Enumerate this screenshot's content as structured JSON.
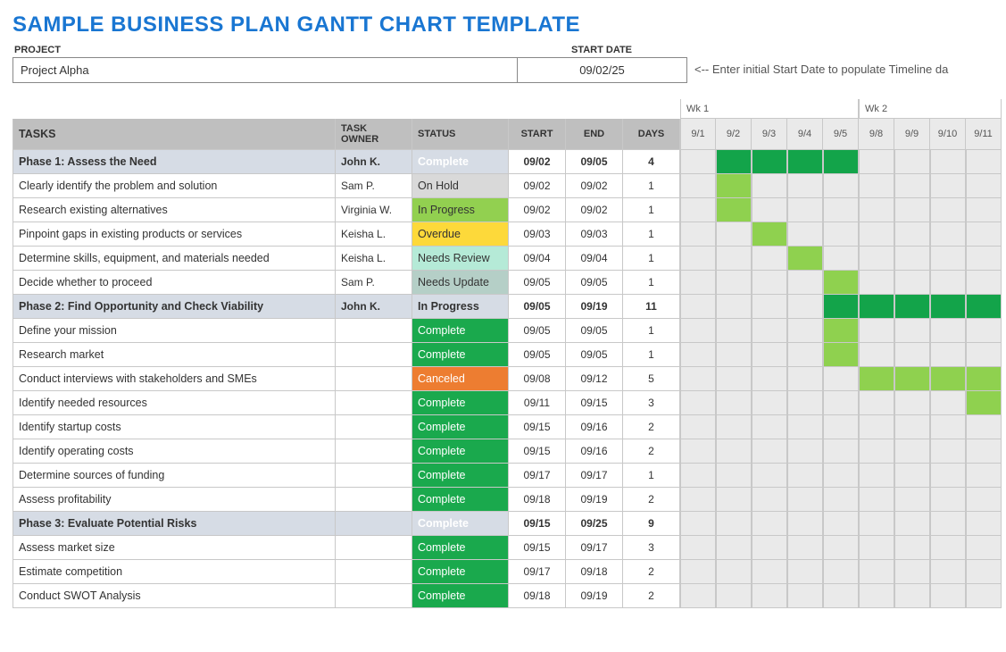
{
  "title": "SAMPLE BUSINESS PLAN GANTT CHART TEMPLATE",
  "meta": {
    "project_label": "PROJECT",
    "project_name": "Project Alpha",
    "start_label": "START DATE",
    "start_date": "09/02/25",
    "note": "<-- Enter initial Start Date to populate Timeline da"
  },
  "headers": {
    "tasks": "TASKS",
    "owner": "TASK OWNER",
    "status": "STATUS",
    "start": "START",
    "end": "END",
    "days": "DAYS"
  },
  "weeks": [
    {
      "label": "Wk 1",
      "dates": [
        "9/1",
        "9/2",
        "9/3",
        "9/4",
        "9/5"
      ]
    },
    {
      "label": "Wk 2",
      "dates": [
        "9/8",
        "9/9",
        "9/10",
        "9/11"
      ]
    }
  ],
  "status_classes": {
    "Complete": "st-complete",
    "On Hold": "st-onhold",
    "In Progress": "st-inprogress",
    "Overdue": "st-overdue",
    "Needs Review": "st-needsreview",
    "Needs Update": "st-needsupdate",
    "Canceled": "st-canceled"
  },
  "timeline_dates": [
    "9/1",
    "9/2",
    "9/3",
    "9/4",
    "9/5",
    "9/8",
    "9/9",
    "9/10",
    "9/11"
  ],
  "rows": [
    {
      "phase": true,
      "task": "Phase 1: Assess the Need",
      "owner": "John K.",
      "status": "Complete",
      "start": "09/02",
      "end": "09/05",
      "days": "4",
      "bars": [
        0,
        1,
        1,
        1,
        1,
        0,
        0,
        0,
        0
      ],
      "bar_type": "phase"
    },
    {
      "phase": false,
      "task": "Clearly identify the problem and solution",
      "owner": "Sam P.",
      "status": "On Hold",
      "start": "09/02",
      "end": "09/02",
      "days": "1",
      "bars": [
        0,
        1,
        0,
        0,
        0,
        0,
        0,
        0,
        0
      ],
      "bar_type": "task"
    },
    {
      "phase": false,
      "task": "Research existing alternatives",
      "owner": "Virginia W.",
      "status": "In Progress",
      "start": "09/02",
      "end": "09/02",
      "days": "1",
      "bars": [
        0,
        1,
        0,
        0,
        0,
        0,
        0,
        0,
        0
      ],
      "bar_type": "task"
    },
    {
      "phase": false,
      "task": "Pinpoint gaps in existing products or services",
      "owner": "Keisha L.",
      "status": "Overdue",
      "start": "09/03",
      "end": "09/03",
      "days": "1",
      "bars": [
        0,
        0,
        1,
        0,
        0,
        0,
        0,
        0,
        0
      ],
      "bar_type": "task"
    },
    {
      "phase": false,
      "task": "Determine skills, equipment, and materials needed",
      "owner": "Keisha L.",
      "status": "Needs Review",
      "start": "09/04",
      "end": "09/04",
      "days": "1",
      "bars": [
        0,
        0,
        0,
        1,
        0,
        0,
        0,
        0,
        0
      ],
      "bar_type": "task"
    },
    {
      "phase": false,
      "task": "Decide whether to proceed",
      "owner": "Sam P.",
      "status": "Needs Update",
      "start": "09/05",
      "end": "09/05",
      "days": "1",
      "bars": [
        0,
        0,
        0,
        0,
        1,
        0,
        0,
        0,
        0
      ],
      "bar_type": "task"
    },
    {
      "phase": true,
      "task": "Phase 2: Find Opportunity and Check Viability",
      "owner": "John K.",
      "status": "In Progress",
      "start": "09/05",
      "end": "09/19",
      "days": "11",
      "bars": [
        0,
        0,
        0,
        0,
        1,
        1,
        1,
        1,
        1
      ],
      "bar_type": "phase"
    },
    {
      "phase": false,
      "task": "Define your mission",
      "owner": "",
      "status": "Complete",
      "start": "09/05",
      "end": "09/05",
      "days": "1",
      "bars": [
        0,
        0,
        0,
        0,
        1,
        0,
        0,
        0,
        0
      ],
      "bar_type": "task"
    },
    {
      "phase": false,
      "task": "Research market",
      "owner": "",
      "status": "Complete",
      "start": "09/05",
      "end": "09/05",
      "days": "1",
      "bars": [
        0,
        0,
        0,
        0,
        1,
        0,
        0,
        0,
        0
      ],
      "bar_type": "task"
    },
    {
      "phase": false,
      "task": "Conduct interviews with stakeholders and SMEs",
      "owner": "",
      "status": "Canceled",
      "start": "09/08",
      "end": "09/12",
      "days": "5",
      "bars": [
        0,
        0,
        0,
        0,
        0,
        1,
        1,
        1,
        1
      ],
      "bar_type": "task"
    },
    {
      "phase": false,
      "task": "Identify needed resources",
      "owner": "",
      "status": "Complete",
      "start": "09/11",
      "end": "09/15",
      "days": "3",
      "bars": [
        0,
        0,
        0,
        0,
        0,
        0,
        0,
        0,
        1
      ],
      "bar_type": "task"
    },
    {
      "phase": false,
      "task": "Identify startup costs",
      "owner": "",
      "status": "Complete",
      "start": "09/15",
      "end": "09/16",
      "days": "2",
      "bars": [
        0,
        0,
        0,
        0,
        0,
        0,
        0,
        0,
        0
      ],
      "bar_type": "task"
    },
    {
      "phase": false,
      "task": "Identify operating costs",
      "owner": "",
      "status": "Complete",
      "start": "09/15",
      "end": "09/16",
      "days": "2",
      "bars": [
        0,
        0,
        0,
        0,
        0,
        0,
        0,
        0,
        0
      ],
      "bar_type": "task"
    },
    {
      "phase": false,
      "task": "Determine sources of funding",
      "owner": "",
      "status": "Complete",
      "start": "09/17",
      "end": "09/17",
      "days": "1",
      "bars": [
        0,
        0,
        0,
        0,
        0,
        0,
        0,
        0,
        0
      ],
      "bar_type": "task"
    },
    {
      "phase": false,
      "task": "Assess profitability",
      "owner": "",
      "status": "Complete",
      "start": "09/18",
      "end": "09/19",
      "days": "2",
      "bars": [
        0,
        0,
        0,
        0,
        0,
        0,
        0,
        0,
        0
      ],
      "bar_type": "task"
    },
    {
      "phase": true,
      "task": "Phase 3: Evaluate Potential Risks",
      "owner": "",
      "status": "Complete",
      "start": "09/15",
      "end": "09/25",
      "days": "9",
      "bars": [
        0,
        0,
        0,
        0,
        0,
        0,
        0,
        0,
        0
      ],
      "bar_type": "phase"
    },
    {
      "phase": false,
      "task": "Assess market size",
      "owner": "",
      "status": "Complete",
      "start": "09/15",
      "end": "09/17",
      "days": "3",
      "bars": [
        0,
        0,
        0,
        0,
        0,
        0,
        0,
        0,
        0
      ],
      "bar_type": "task"
    },
    {
      "phase": false,
      "task": "Estimate competition",
      "owner": "",
      "status": "Complete",
      "start": "09/17",
      "end": "09/18",
      "days": "2",
      "bars": [
        0,
        0,
        0,
        0,
        0,
        0,
        0,
        0,
        0
      ],
      "bar_type": "task"
    },
    {
      "phase": false,
      "task": "Conduct SWOT Analysis",
      "owner": "",
      "status": "Complete",
      "start": "09/18",
      "end": "09/19",
      "days": "2",
      "bars": [
        0,
        0,
        0,
        0,
        0,
        0,
        0,
        0,
        0
      ],
      "bar_type": "task"
    }
  ],
  "chart_data": {
    "type": "table",
    "title": "Sample Business Plan Gantt Chart Template",
    "project": "Project Alpha",
    "start_date": "09/02/25",
    "timeline_visible_dates": [
      "9/1",
      "9/2",
      "9/3",
      "9/4",
      "9/5",
      "9/8",
      "9/9",
      "9/10",
      "9/11"
    ],
    "tasks": [
      {
        "name": "Phase 1: Assess the Need",
        "owner": "John K.",
        "status": "Complete",
        "start": "09/02",
        "end": "09/05",
        "days": 4,
        "level": "phase"
      },
      {
        "name": "Clearly identify the problem and solution",
        "owner": "Sam P.",
        "status": "On Hold",
        "start": "09/02",
        "end": "09/02",
        "days": 1,
        "level": "task"
      },
      {
        "name": "Research existing alternatives",
        "owner": "Virginia W.",
        "status": "In Progress",
        "start": "09/02",
        "end": "09/02",
        "days": 1,
        "level": "task"
      },
      {
        "name": "Pinpoint gaps in existing products or services",
        "owner": "Keisha L.",
        "status": "Overdue",
        "start": "09/03",
        "end": "09/03",
        "days": 1,
        "level": "task"
      },
      {
        "name": "Determine skills, equipment, and materials needed",
        "owner": "Keisha L.",
        "status": "Needs Review",
        "start": "09/04",
        "end": "09/04",
        "days": 1,
        "level": "task"
      },
      {
        "name": "Decide whether to proceed",
        "owner": "Sam P.",
        "status": "Needs Update",
        "start": "09/05",
        "end": "09/05",
        "days": 1,
        "level": "task"
      },
      {
        "name": "Phase 2: Find Opportunity and Check Viability",
        "owner": "John K.",
        "status": "In Progress",
        "start": "09/05",
        "end": "09/19",
        "days": 11,
        "level": "phase"
      },
      {
        "name": "Define your mission",
        "owner": "",
        "status": "Complete",
        "start": "09/05",
        "end": "09/05",
        "days": 1,
        "level": "task"
      },
      {
        "name": "Research market",
        "owner": "",
        "status": "Complete",
        "start": "09/05",
        "end": "09/05",
        "days": 1,
        "level": "task"
      },
      {
        "name": "Conduct interviews with stakeholders and SMEs",
        "owner": "",
        "status": "Canceled",
        "start": "09/08",
        "end": "09/12",
        "days": 5,
        "level": "task"
      },
      {
        "name": "Identify needed resources",
        "owner": "",
        "status": "Complete",
        "start": "09/11",
        "end": "09/15",
        "days": 3,
        "level": "task"
      },
      {
        "name": "Identify startup costs",
        "owner": "",
        "status": "Complete",
        "start": "09/15",
        "end": "09/16",
        "days": 2,
        "level": "task"
      },
      {
        "name": "Identify operating costs",
        "owner": "",
        "status": "Complete",
        "start": "09/15",
        "end": "09/16",
        "days": 2,
        "level": "task"
      },
      {
        "name": "Determine sources of funding",
        "owner": "",
        "status": "Complete",
        "start": "09/17",
        "end": "09/17",
        "days": 1,
        "level": "task"
      },
      {
        "name": "Assess profitability",
        "owner": "",
        "status": "Complete",
        "start": "09/18",
        "end": "09/19",
        "days": 2,
        "level": "task"
      },
      {
        "name": "Phase 3: Evaluate Potential Risks",
        "owner": "",
        "status": "Complete",
        "start": "09/15",
        "end": "09/25",
        "days": 9,
        "level": "phase"
      },
      {
        "name": "Assess market size",
        "owner": "",
        "status": "Complete",
        "start": "09/15",
        "end": "09/17",
        "days": 3,
        "level": "task"
      },
      {
        "name": "Estimate competition",
        "owner": "",
        "status": "Complete",
        "start": "09/17",
        "end": "09/18",
        "days": 2,
        "level": "task"
      },
      {
        "name": "Conduct SWOT Analysis",
        "owner": "",
        "status": "Complete",
        "start": "09/18",
        "end": "09/19",
        "days": 2,
        "level": "task"
      }
    ]
  }
}
